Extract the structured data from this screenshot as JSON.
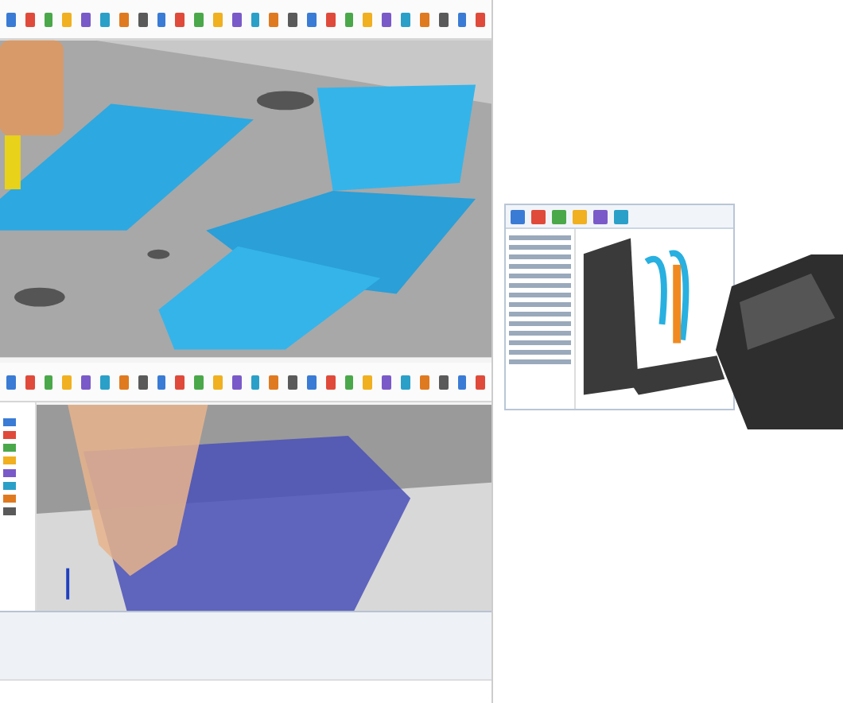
{
  "views": [
    {
      "kind": "mold-toolpath"
    },
    {
      "kind": "tool-simulation"
    }
  ],
  "showcase": {
    "kind": "part-window"
  }
}
